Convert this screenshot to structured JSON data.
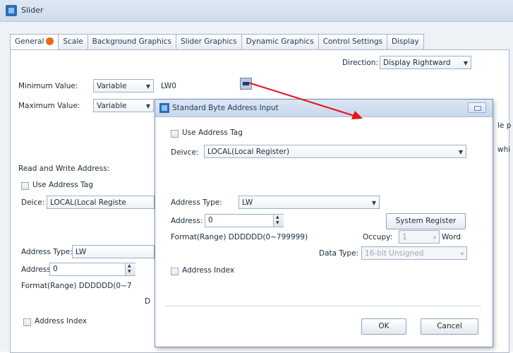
{
  "window": {
    "title": "Slider"
  },
  "tabs": [
    {
      "label": "General"
    },
    {
      "label": "Scale"
    },
    {
      "label": "Background Graphics"
    },
    {
      "label": "Slider Graphics"
    },
    {
      "label": "Dynamic Graphics"
    },
    {
      "label": "Control Settings"
    },
    {
      "label": "Display"
    }
  ],
  "general": {
    "direction_label": "Direction:",
    "direction_value": "Display Rightward",
    "min_label": "Minimum Value:",
    "min_type": "Variable",
    "min_address": "LW0",
    "max_label": "Maximum Value:",
    "max_type": "Variable",
    "rw_label": "Read and Write Address:",
    "use_tag": "Use Address Tag",
    "device_label": "Deice:",
    "device_value": "LOCAL(Local Registe",
    "addr_type_label": "Address Type:",
    "addr_type_value": "LW",
    "address_label": "Address:",
    "address_value": "0",
    "format": "Format(Range) DDDDDD(0~7",
    "partial_d": "D",
    "address_index": "Address Index",
    "clip_right_1": "le p",
    "clip_right_2": "whi"
  },
  "dialog": {
    "title": "Standard Byte Address Input",
    "use_tag": "Use Address Tag",
    "device_label": "Deivce:",
    "device_value": "LOCAL(Local Register)",
    "addr_type_label": "Address Type:",
    "addr_type_value": "LW",
    "address_label": "Address:",
    "address_value": "0",
    "system_register": "System Register",
    "format": "Format(Range) DDDDDD(0~799999)",
    "occupy_label": "Occupy:",
    "occupy_value": "1",
    "occupy_unit": "Word",
    "data_type_label": "Data Type:",
    "data_type_value": "16-bit Unsigned",
    "address_index": "Address Index",
    "ok": "OK",
    "cancel": "Cancel"
  },
  "annotation": {
    "arrow_color": "#e8101a"
  }
}
